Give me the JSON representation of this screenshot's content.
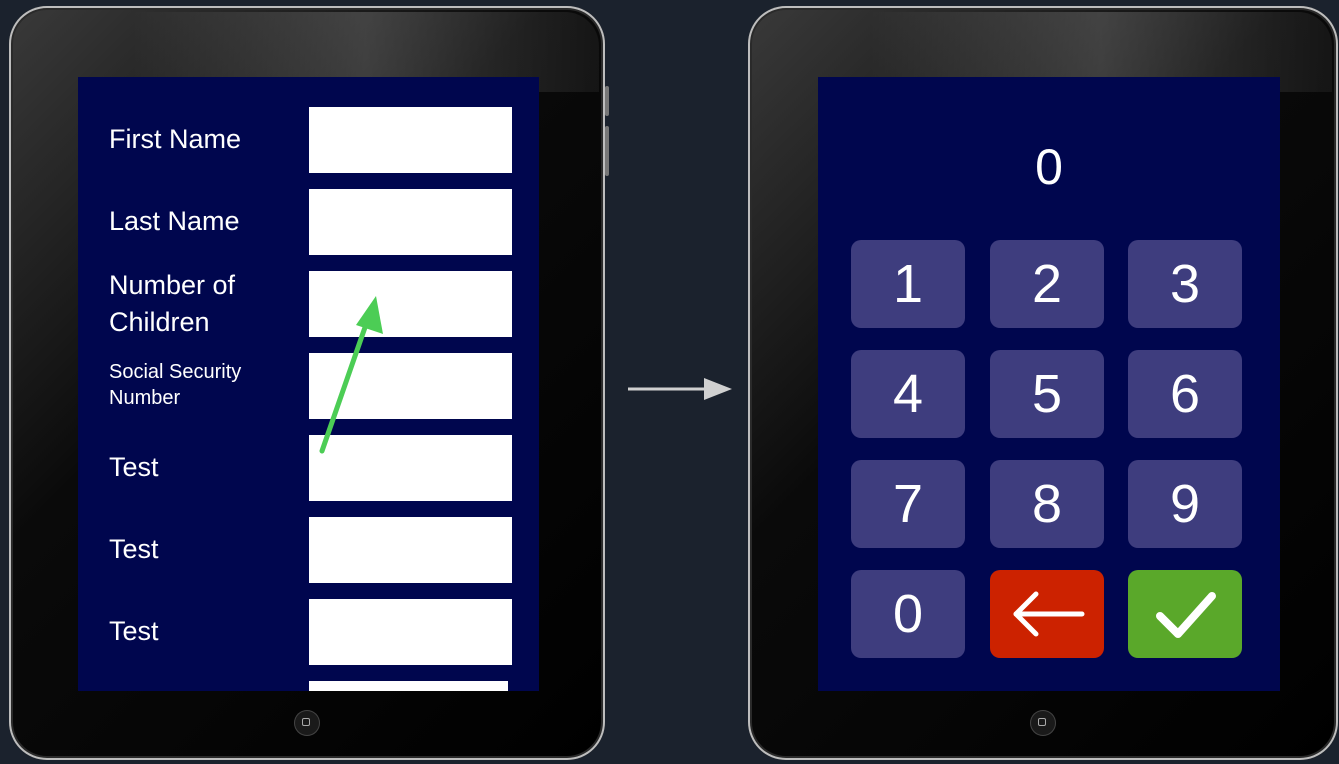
{
  "form": {
    "fields": [
      {
        "label": "First Name",
        "value": ""
      },
      {
        "label": "Last Name",
        "value": ""
      },
      {
        "label": "Number of\nChildren",
        "value": ""
      },
      {
        "label": "Social Security\nNumber",
        "value": ""
      },
      {
        "label": "Test",
        "value": ""
      },
      {
        "label": "Test",
        "value": ""
      },
      {
        "label": "Test",
        "value": ""
      }
    ]
  },
  "keypad": {
    "display": "0",
    "keys": [
      "1",
      "2",
      "3",
      "4",
      "5",
      "6",
      "7",
      "8",
      "9",
      "0"
    ]
  },
  "colors": {
    "screen_bg": "#00064e",
    "key_bg": "#3e3d7e",
    "backspace": "#cc2200",
    "confirm": "#5aa82a",
    "annotation_arrow": "#4ccd55"
  },
  "icons": {
    "backspace": "left-arrow-icon",
    "confirm": "checkmark-icon"
  }
}
